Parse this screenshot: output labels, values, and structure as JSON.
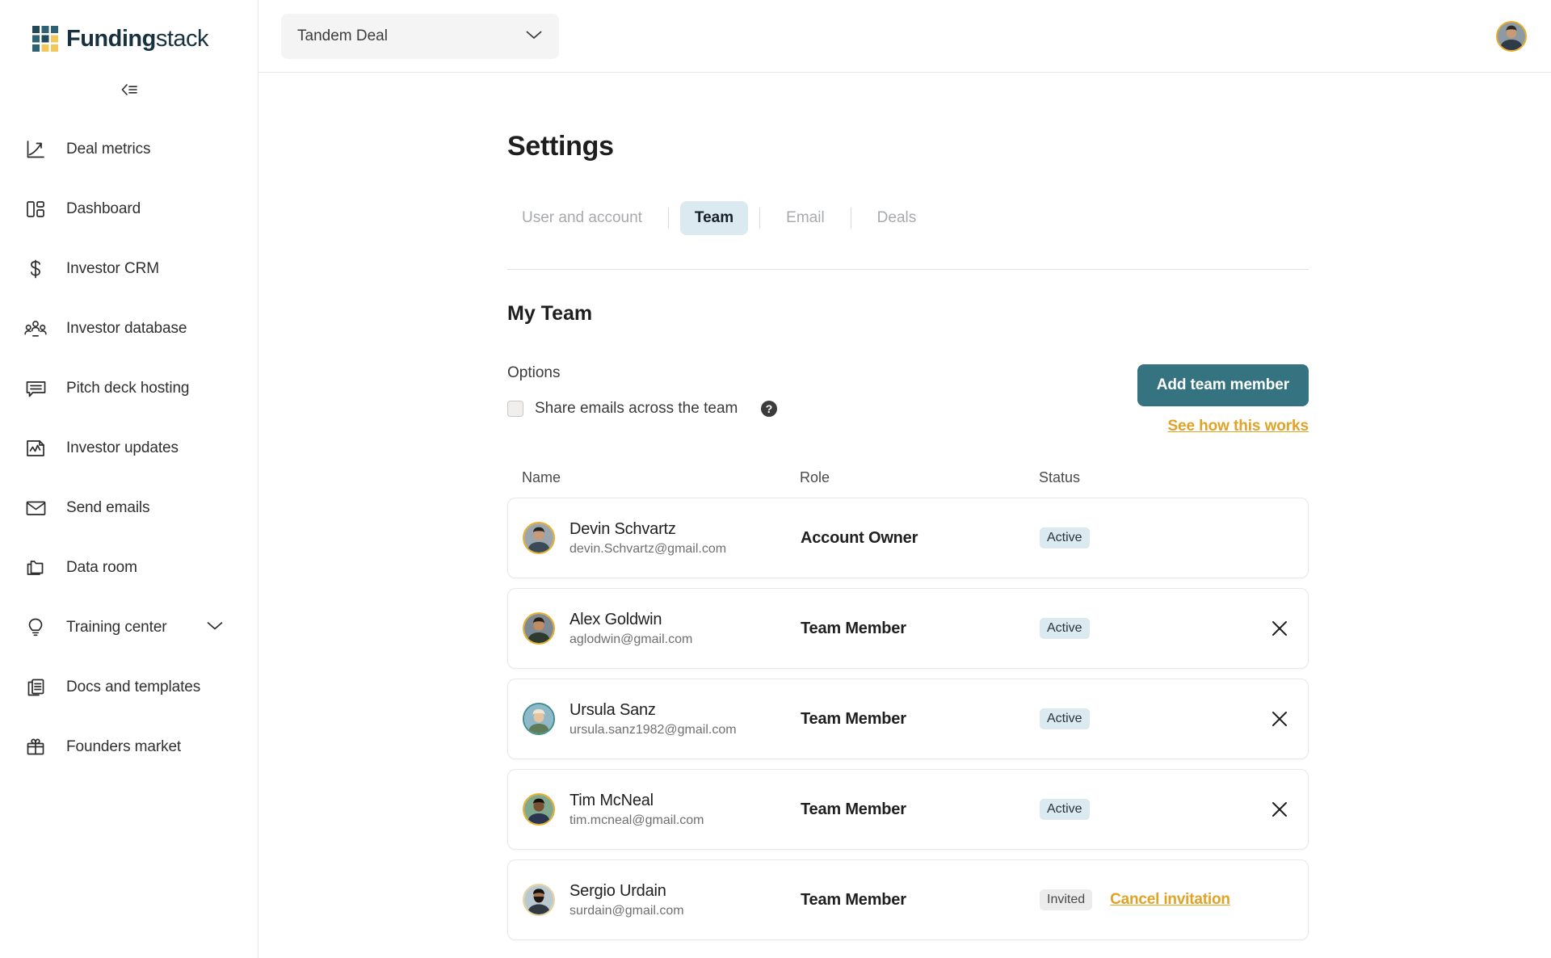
{
  "brand": {
    "name_bold": "Funding",
    "name_light": "stack",
    "logo_colors": {
      "dark": "#23485a",
      "yellow": "#f2c75c",
      "teal": "#2e6173"
    }
  },
  "sidebar": {
    "collapse_icon": "collapse-left-icon",
    "items": [
      {
        "label": "Deal metrics",
        "icon": "line-chart-icon",
        "has_chevron": false
      },
      {
        "label": "Dashboard",
        "icon": "dashboard-layout-icon",
        "has_chevron": false
      },
      {
        "label": "Investor CRM",
        "icon": "dollar-sign-icon",
        "has_chevron": false
      },
      {
        "label": "Investor database",
        "icon": "people-group-icon",
        "has_chevron": false
      },
      {
        "label": "Pitch deck hosting",
        "icon": "presentation-icon",
        "has_chevron": false
      },
      {
        "label": "Investor updates",
        "icon": "chart-document-icon",
        "has_chevron": false
      },
      {
        "label": "Send emails",
        "icon": "envelope-icon",
        "has_chevron": false
      },
      {
        "label": "Data room",
        "icon": "folders-icon",
        "has_chevron": false
      },
      {
        "label": "Training center",
        "icon": "lightbulb-icon",
        "has_chevron": true
      },
      {
        "label": "Docs and templates",
        "icon": "documents-copy-icon",
        "has_chevron": false
      },
      {
        "label": "Founders market",
        "icon": "gift-icon",
        "has_chevron": false
      }
    ]
  },
  "topbar": {
    "deal_selector_value": "Tandem Deal",
    "deal_selector_icon": "chevron-down-icon",
    "user_avatar": "user-avatar"
  },
  "page": {
    "title": "Settings",
    "tabs": [
      {
        "label": "User and account",
        "active": false
      },
      {
        "label": "Team",
        "active": true
      },
      {
        "label": "Email",
        "active": false
      },
      {
        "label": "Deals",
        "active": false
      }
    ],
    "section_title": "My Team"
  },
  "options": {
    "label": "Options",
    "share_emails_label": "Share emails across the team",
    "share_emails_checked": false,
    "help_icon": "help-circle-icon",
    "add_member_label": "Add team member",
    "see_how_label": "See how this works",
    "accent_button": "#367380",
    "accent_link": "#e0a326"
  },
  "table": {
    "headers": {
      "name": "Name",
      "role": "Role",
      "status": "Status"
    },
    "rows": [
      {
        "name": "Devin Schvartz",
        "email": "devin.Schvartz@gmail.com",
        "role": "Account Owner",
        "status": "Active",
        "status_type": "active",
        "removable": false,
        "action_label": ""
      },
      {
        "name": "Alex Goldwin",
        "email": "aglodwin@gmail.com",
        "role": "Team Member",
        "status": "Active",
        "status_type": "active",
        "removable": true,
        "action_label": ""
      },
      {
        "name": "Ursula Sanz",
        "email": "ursula.sanz1982@gmail.com",
        "role": "Team Member",
        "status": "Active",
        "status_type": "active",
        "removable": true,
        "action_label": ""
      },
      {
        "name": "Tim McNeal",
        "email": "tim.mcneal@gmail.com",
        "role": "Team Member",
        "status": "Active",
        "status_type": "active",
        "removable": true,
        "action_label": ""
      },
      {
        "name": "Sergio Urdain",
        "email": "surdain@gmail.com",
        "role": "Team Member",
        "status": "Invited",
        "status_type": "invited",
        "removable": false,
        "action_label": "Cancel invitation"
      }
    ]
  }
}
